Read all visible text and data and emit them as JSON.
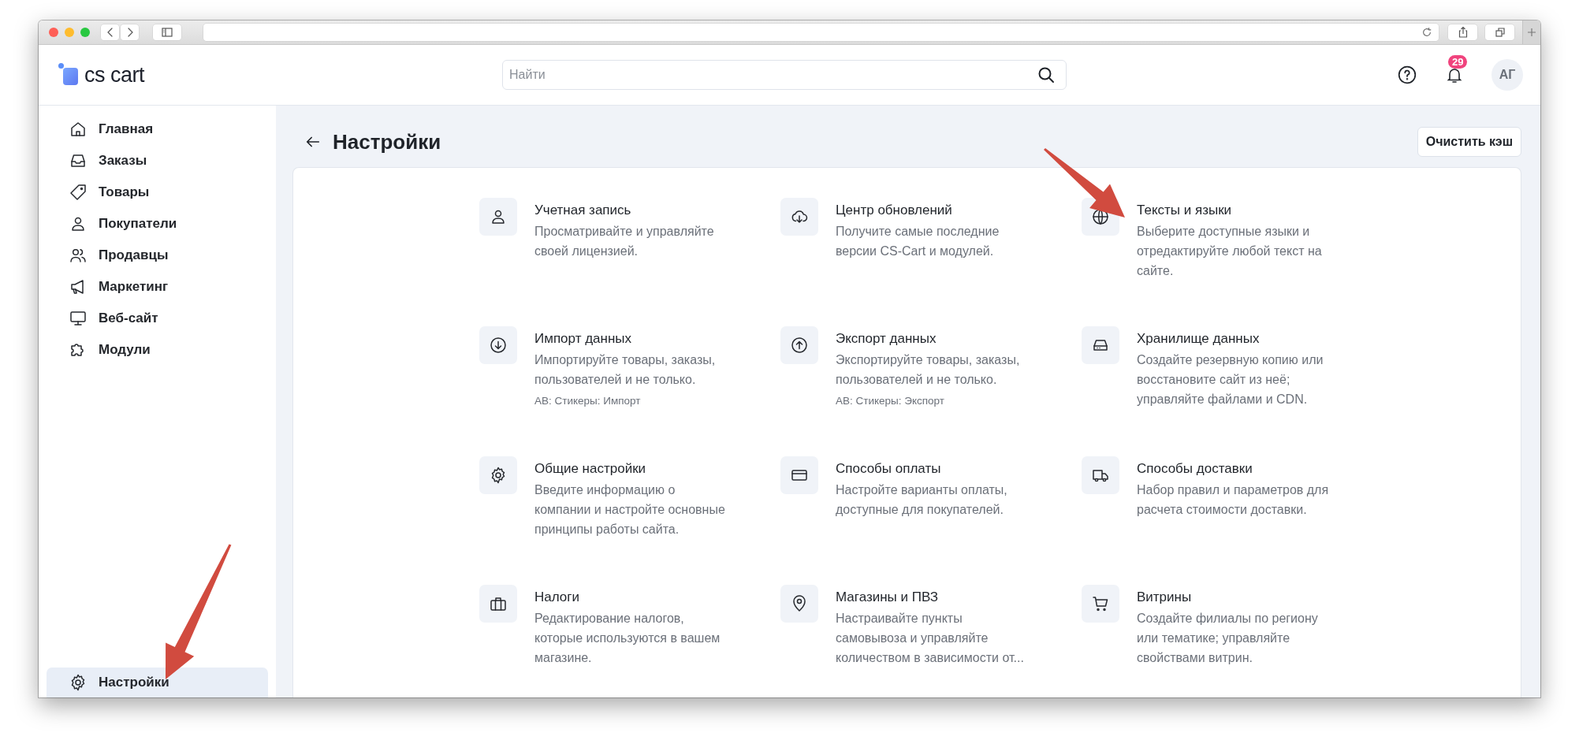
{
  "header": {
    "logo": "cs cart",
    "search": {
      "placeholder": "Найти"
    },
    "notifications": "29",
    "avatar": "АГ"
  },
  "sidebar": {
    "items": [
      {
        "label": "Главная",
        "selected": false
      },
      {
        "label": "Заказы",
        "selected": false
      },
      {
        "label": "Товары",
        "selected": false
      },
      {
        "label": "Покупатели",
        "selected": false
      },
      {
        "label": "Продавцы",
        "selected": false
      },
      {
        "label": "Маркетинг",
        "selected": false
      },
      {
        "label": "Веб-сайт",
        "selected": false
      },
      {
        "label": "Модули",
        "selected": false
      }
    ],
    "bottom_items": [
      {
        "label": "Настройки",
        "selected": true
      }
    ]
  },
  "page": {
    "title": "Настройки",
    "button": "Очистить кэш"
  },
  "settings": [
    {
      "title": "Учетная запись",
      "description": "Просматривайте и управляйте своей лицензией."
    },
    {
      "title": "Центр обновлений",
      "description": "Получите самые последние версии CS-Cart и модулей."
    },
    {
      "title": "Тексты и языки",
      "description": "Выберите доступные языки и отредактируйте любой текст на сайте."
    },
    {
      "title": "Импорт данных",
      "description": "Импортируйте товары, заказы, пользователей и не только.",
      "note": "АВ: Стикеры: Импорт"
    },
    {
      "title": "Экспорт данных",
      "description": "Экспортируйте товары, заказы, пользователей и не только.",
      "note": "АВ: Стикеры: Экспорт"
    },
    {
      "title": "Хранилище данных",
      "description": "Создайте резервную копию или восстановите сайт из неё; управляйте файлами и CDN."
    },
    {
      "title": "Общие настройки",
      "description": "Введите информацию о компании и настройте основные принципы работы сайта."
    },
    {
      "title": "Способы оплаты",
      "description": "Настройте варианты оплаты, доступные для покупателей."
    },
    {
      "title": "Способы доставки",
      "description": "Набор правил и параметров для расчета стоимости доставки."
    },
    {
      "title": "Налоги",
      "description": "Редактирование налогов, которые используются в вашем магазине."
    },
    {
      "title": "Магазины и ПВЗ",
      "description": "Настраивайте пункты самовывоза и управляйте количеством в зависимости от..."
    },
    {
      "title": "Витрины",
      "description": "Создайте филиалы по региону или тематике; управляйте свойствами витрин."
    }
  ]
}
